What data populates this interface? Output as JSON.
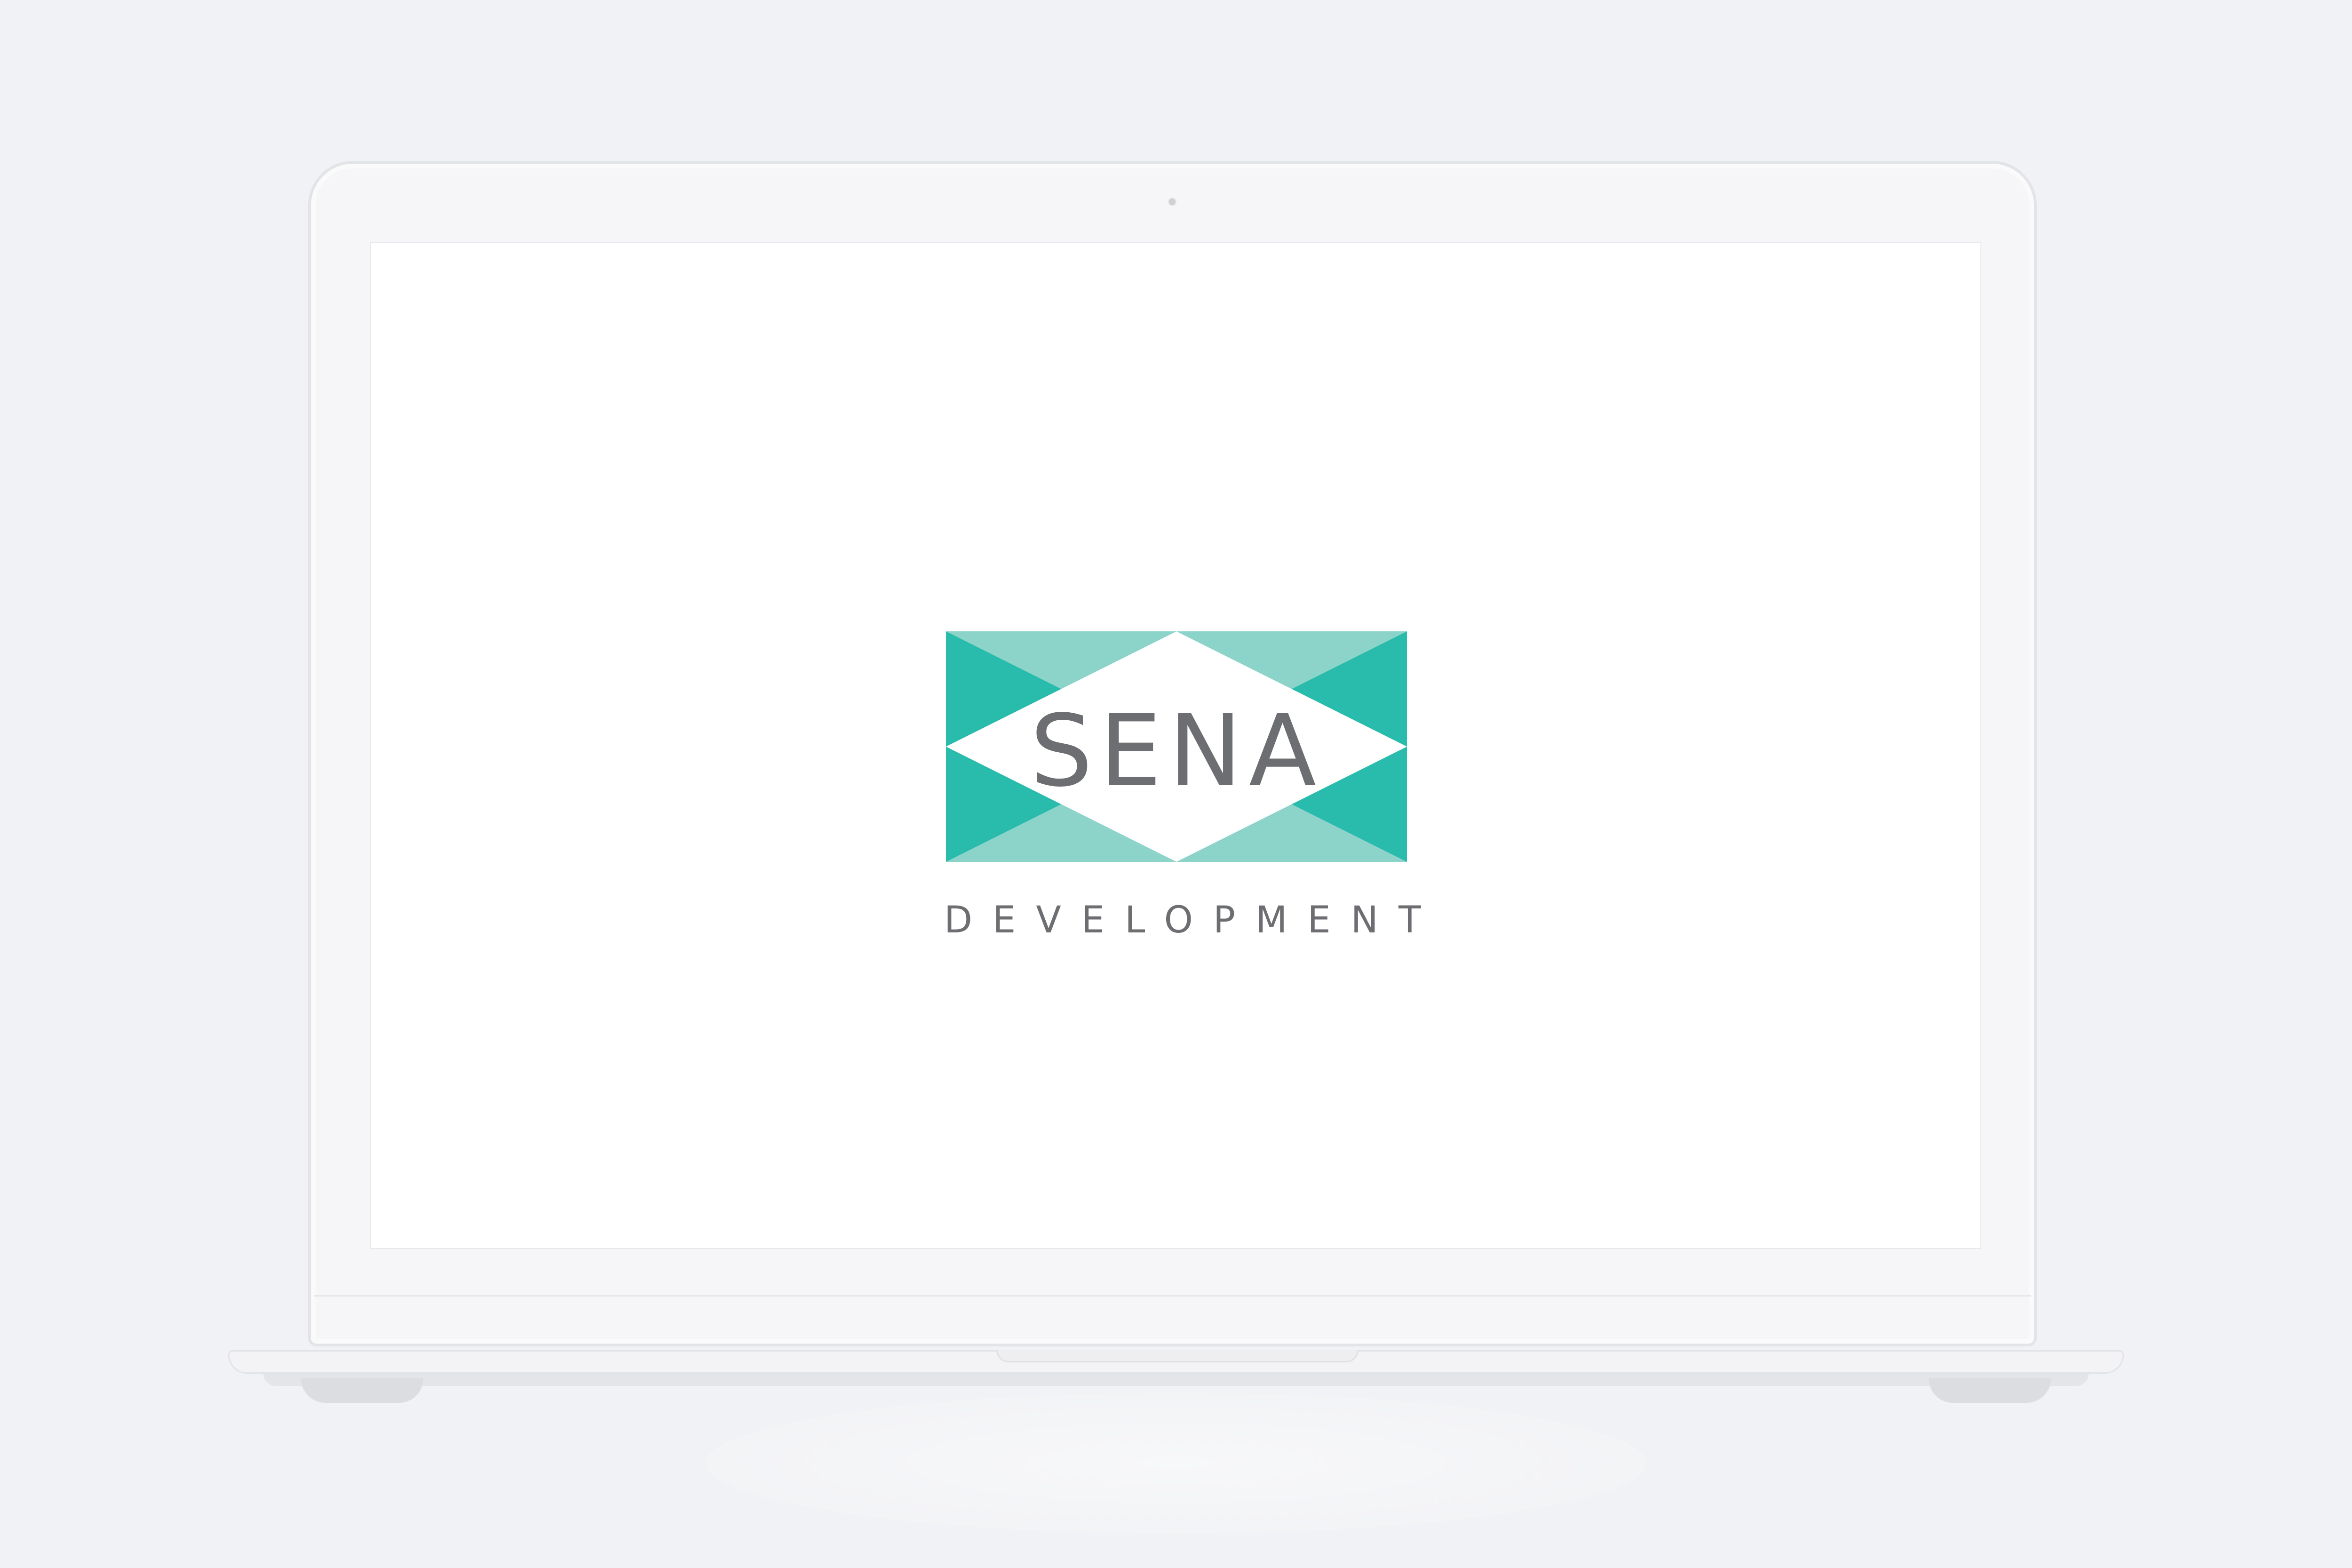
{
  "device": {
    "type": "laptop",
    "color": "#f6f6f8"
  },
  "screen": {
    "background": "#ffffff",
    "logo": {
      "word": "SENA",
      "tagline": "DEVELOPMENT",
      "colors": {
        "teal_dark": "#29bcad",
        "teal_light": "#8cd3c9",
        "text_gray": "#6d6e71"
      }
    }
  }
}
